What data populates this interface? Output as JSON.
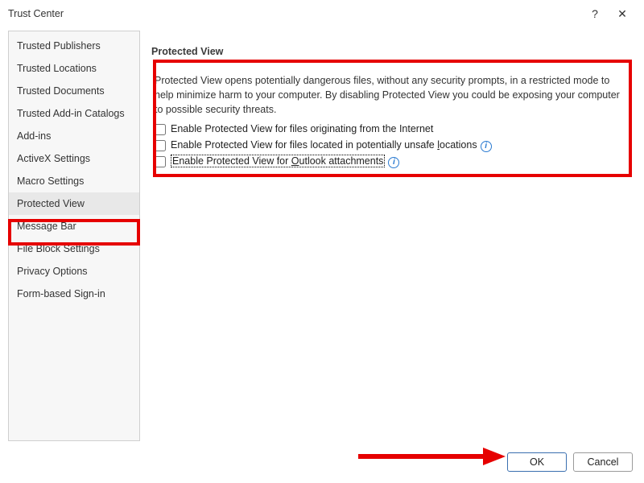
{
  "window": {
    "title": "Trust Center",
    "help_tooltip": "?",
    "close_tooltip": "✕"
  },
  "sidebar": {
    "items": [
      {
        "label": "Trusted Publishers"
      },
      {
        "label": "Trusted Locations"
      },
      {
        "label": "Trusted Documents"
      },
      {
        "label": "Trusted Add-in Catalogs"
      },
      {
        "label": "Add-ins"
      },
      {
        "label": "ActiveX Settings"
      },
      {
        "label": "Macro Settings"
      },
      {
        "label": "Protected View",
        "selected": true
      },
      {
        "label": "Message Bar"
      },
      {
        "label": "File Block Settings"
      },
      {
        "label": "Privacy Options"
      },
      {
        "label": "Form-based Sign-in"
      }
    ]
  },
  "main": {
    "heading": "Protected View",
    "description": "Protected View opens potentially dangerous files, without any security prompts, in a restricted mode to help minimize harm to your computer. By disabling Protected View you could be exposing your computer to possible security threats.",
    "checks": [
      {
        "label": "Enable Protected View for files originating from the Internet",
        "checked": false,
        "info": false,
        "focused": false
      },
      {
        "label_pre": "Enable Protected View for files located in potentially unsafe ",
        "accessKey": "l",
        "label_post": "ocations",
        "checked": false,
        "info": true,
        "focused": false
      },
      {
        "label_pre": "Enable Protected View for ",
        "accessKey": "O",
        "label_post": "utlook attachments",
        "checked": false,
        "info": true,
        "focused": true
      }
    ]
  },
  "footer": {
    "ok": "OK",
    "cancel": "Cancel"
  },
  "highlight_color": "#e60000"
}
